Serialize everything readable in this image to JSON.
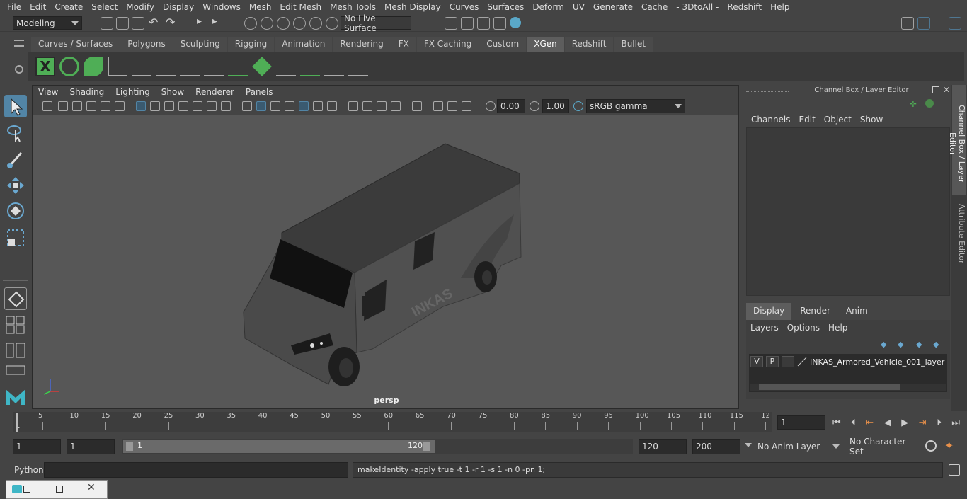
{
  "menubar": {
    "items": [
      "File",
      "Edit",
      "Create",
      "Select",
      "Modify",
      "Display",
      "Windows",
      "Mesh",
      "Edit Mesh",
      "Mesh Tools",
      "Mesh Display",
      "Curves",
      "Surfaces",
      "Deform",
      "UV",
      "Generate",
      "Cache",
      "- 3DtoAll -",
      "Redshift",
      "Help"
    ]
  },
  "statusline": {
    "mode": "Modeling",
    "live_surface": "No Live Surface"
  },
  "shelf": {
    "tabs": [
      "Curves / Surfaces",
      "Polygons",
      "Sculpting",
      "Rigging",
      "Animation",
      "Rendering",
      "FX",
      "FX Caching",
      "Custom",
      "XGen",
      "Redshift",
      "Bullet"
    ],
    "active_tab": "XGen"
  },
  "viewport": {
    "menu": [
      "View",
      "Shading",
      "Lighting",
      "Show",
      "Renderer",
      "Panels"
    ],
    "exposure": "0.00",
    "gamma": "1.00",
    "color_space": "sRGB gamma",
    "camera_label": "persp",
    "vehicle_text": "INKAS"
  },
  "channelbox": {
    "title": "Channel Box / Layer Editor",
    "menu": [
      "Channels",
      "Edit",
      "Object",
      "Show"
    ],
    "layer_tabs": [
      "Display",
      "Render",
      "Anim"
    ],
    "active_layer_tab": "Display",
    "layer_menu": [
      "Layers",
      "Options",
      "Help"
    ],
    "layer": {
      "v": "V",
      "p": "P",
      "name": "INKAS_Armored_Vehicle_001_layer"
    }
  },
  "sidetabs": [
    "Channel Box / Layer Editor",
    "Attribute Editor"
  ],
  "timeline": {
    "ticks": [
      "5",
      "10",
      "15",
      "20",
      "25",
      "30",
      "35",
      "40",
      "45",
      "50",
      "55",
      "60",
      "65",
      "70",
      "75",
      "80",
      "85",
      "90",
      "95",
      "100",
      "105",
      "110",
      "115",
      "12"
    ],
    "start_label": "1",
    "current_frame": "1"
  },
  "range": {
    "start": "1",
    "playback_start": "1",
    "slider_start": "1",
    "slider_end": "120",
    "playback_end": "120",
    "end": "200",
    "anim_layer": "No Anim Layer",
    "character_set": "No Character Set"
  },
  "cmdline": {
    "language": "Python",
    "result": "makeIdentity -apply true -t 1 -r 1 -s 1 -n 0 -pn 1;"
  },
  "colors": {
    "accent": "#5285a6",
    "xgen_green": "#4fae56"
  }
}
